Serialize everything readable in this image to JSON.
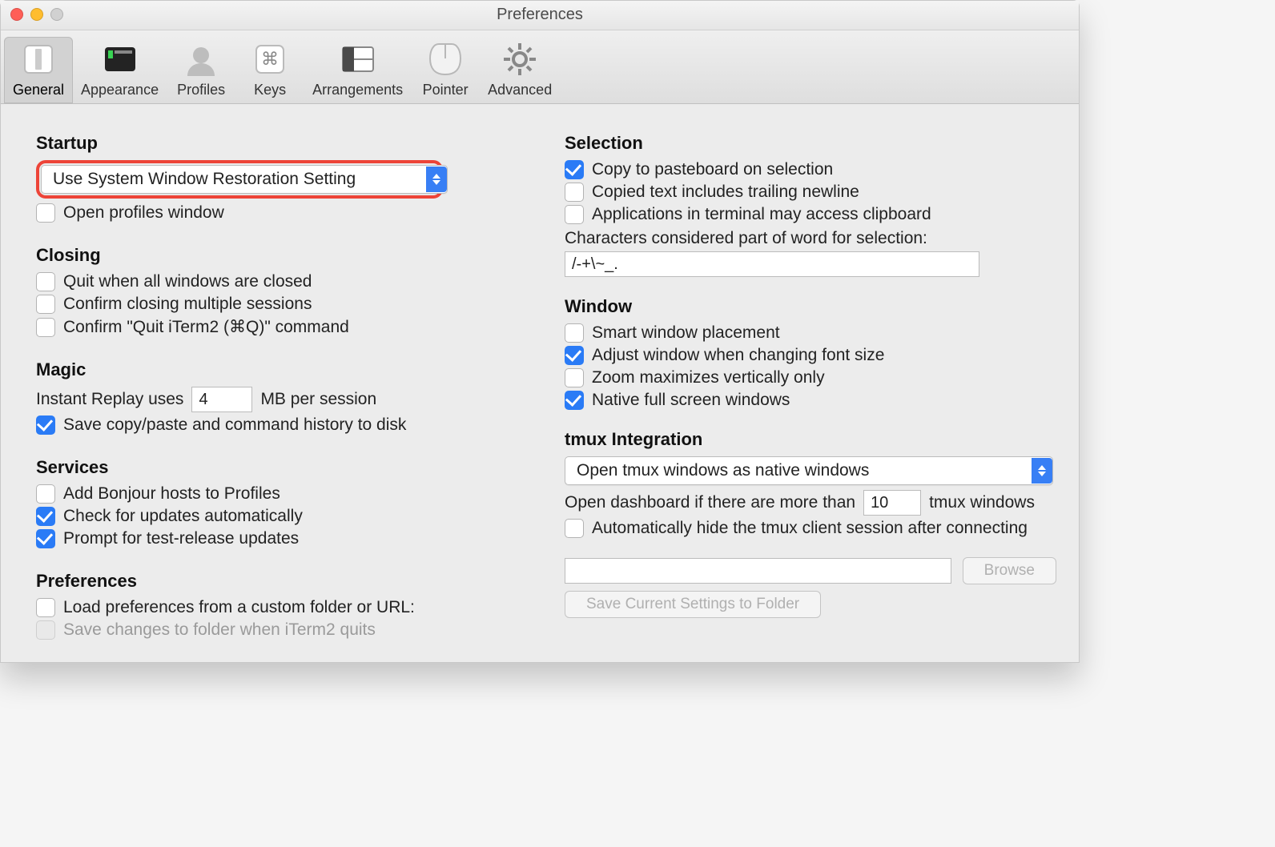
{
  "window": {
    "title": "Preferences"
  },
  "toolbar": {
    "items": [
      {
        "label": "General",
        "selected": true,
        "icon": "general"
      },
      {
        "label": "Appearance",
        "selected": false,
        "icon": "appearance"
      },
      {
        "label": "Profiles",
        "selected": false,
        "icon": "profiles"
      },
      {
        "label": "Keys",
        "selected": false,
        "icon": "keys"
      },
      {
        "label": "Arrangements",
        "selected": false,
        "icon": "arrangements"
      },
      {
        "label": "Pointer",
        "selected": false,
        "icon": "pointer"
      },
      {
        "label": "Advanced",
        "selected": false,
        "icon": "advanced"
      }
    ]
  },
  "general": {
    "startup": {
      "heading": "Startup",
      "popup_value": "Use System Window Restoration Setting",
      "open_profiles_window": {
        "label": "Open profiles window",
        "checked": false
      }
    },
    "closing": {
      "heading": "Closing",
      "quit_all_closed": {
        "label": "Quit when all windows are closed",
        "checked": false
      },
      "confirm_multi": {
        "label": "Confirm closing multiple sessions",
        "checked": false
      },
      "confirm_quit": {
        "label": "Confirm \"Quit iTerm2 (⌘Q)\" command",
        "checked": false
      }
    },
    "magic": {
      "heading": "Magic",
      "instant_replay_pre": "Instant Replay uses",
      "instant_replay_value": "4",
      "instant_replay_post": "MB per session",
      "save_history": {
        "label": "Save copy/paste and command history to disk",
        "checked": true
      }
    },
    "services": {
      "heading": "Services",
      "bonjour": {
        "label": "Add Bonjour hosts to Profiles",
        "checked": false
      },
      "check_updates": {
        "label": "Check for updates automatically",
        "checked": true
      },
      "test_release": {
        "label": "Prompt for test-release updates",
        "checked": true
      }
    },
    "preferences": {
      "heading": "Preferences",
      "load_custom": {
        "label": "Load preferences from a custom folder or URL:",
        "checked": false
      },
      "save_on_quit": {
        "label": "Save changes to folder when iTerm2 quits",
        "checked": false,
        "disabled": true
      },
      "folder_path": "",
      "browse_btn": "Browse",
      "save_btn": "Save Current Settings to Folder"
    },
    "selection": {
      "heading": "Selection",
      "copy_on_select": {
        "label": "Copy to pasteboard on selection",
        "checked": true
      },
      "trailing_newline": {
        "label": "Copied text includes trailing newline",
        "checked": false
      },
      "apps_access_clipboard": {
        "label": "Applications in terminal may access clipboard",
        "checked": false
      },
      "word_chars_label": "Characters considered part of word for selection:",
      "word_chars_value": "/-+\\~_."
    },
    "windowSec": {
      "heading": "Window",
      "smart_placement": {
        "label": "Smart window placement",
        "checked": false
      },
      "adjust_font": {
        "label": "Adjust window when changing font size",
        "checked": true
      },
      "zoom_vertical": {
        "label": "Zoom maximizes vertically only",
        "checked": false
      },
      "native_fullscreen": {
        "label": "Native full screen windows",
        "checked": true
      }
    },
    "tmux": {
      "heading": "tmux Integration",
      "popup_value": "Open tmux windows as native windows",
      "dashboard_pre": "Open dashboard if there are more than",
      "dashboard_value": "10",
      "dashboard_post": "tmux windows",
      "auto_hide": {
        "label": "Automatically hide the tmux client session after connecting",
        "checked": false
      }
    }
  }
}
